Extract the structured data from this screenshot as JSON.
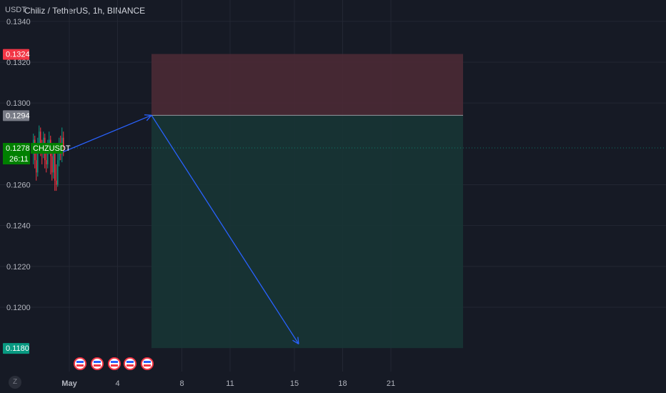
{
  "header": {
    "currency": "USDT",
    "title": "Chiliz / TetherUS, 1h, BINANCE"
  },
  "footer": {
    "z_button": "Z"
  },
  "colors": {
    "background": "#161a25",
    "grid": "#232733",
    "stop_zone": "#4a2a35",
    "target_zone": "#173535",
    "arrow": "#2962ff",
    "stop_label": "#f23645",
    "entry_label": "#787b86",
    "target_label": "#089981",
    "current_label": "#008000"
  },
  "chart_data": {
    "type": "line",
    "title": "Chiliz / TetherUS, 1h, BINANCE",
    "ylabel": "USDT",
    "ylim": [
      0.1175,
      0.1345
    ],
    "y_ticks": [
      "0.1340",
      "0.1320",
      "0.1300",
      "0.1260",
      "0.1240",
      "0.1220",
      "0.1200"
    ],
    "x_ticks": [
      "May",
      "4",
      "8",
      "11",
      "15",
      "18",
      "21"
    ],
    "price_labels": {
      "stop": {
        "text": "0.1324",
        "value": 0.1324
      },
      "entry": {
        "text": "0.1294",
        "value": 0.1294
      },
      "current": {
        "text": "0.1278",
        "value": 0.1278
      },
      "target": {
        "text": "0.1180",
        "value": 0.118
      }
    },
    "symbol_label": "CHZUSDT",
    "countdown": "26:11",
    "position": {
      "entry": 0.1294,
      "stop": 0.1324,
      "target": 0.118
    },
    "projection": [
      {
        "x": "Apr 29",
        "y": 0.1276
      },
      {
        "x": "May 5",
        "y": 0.1294
      },
      {
        "x": "May 15",
        "y": 0.1182
      }
    ],
    "event_markers": 5
  }
}
